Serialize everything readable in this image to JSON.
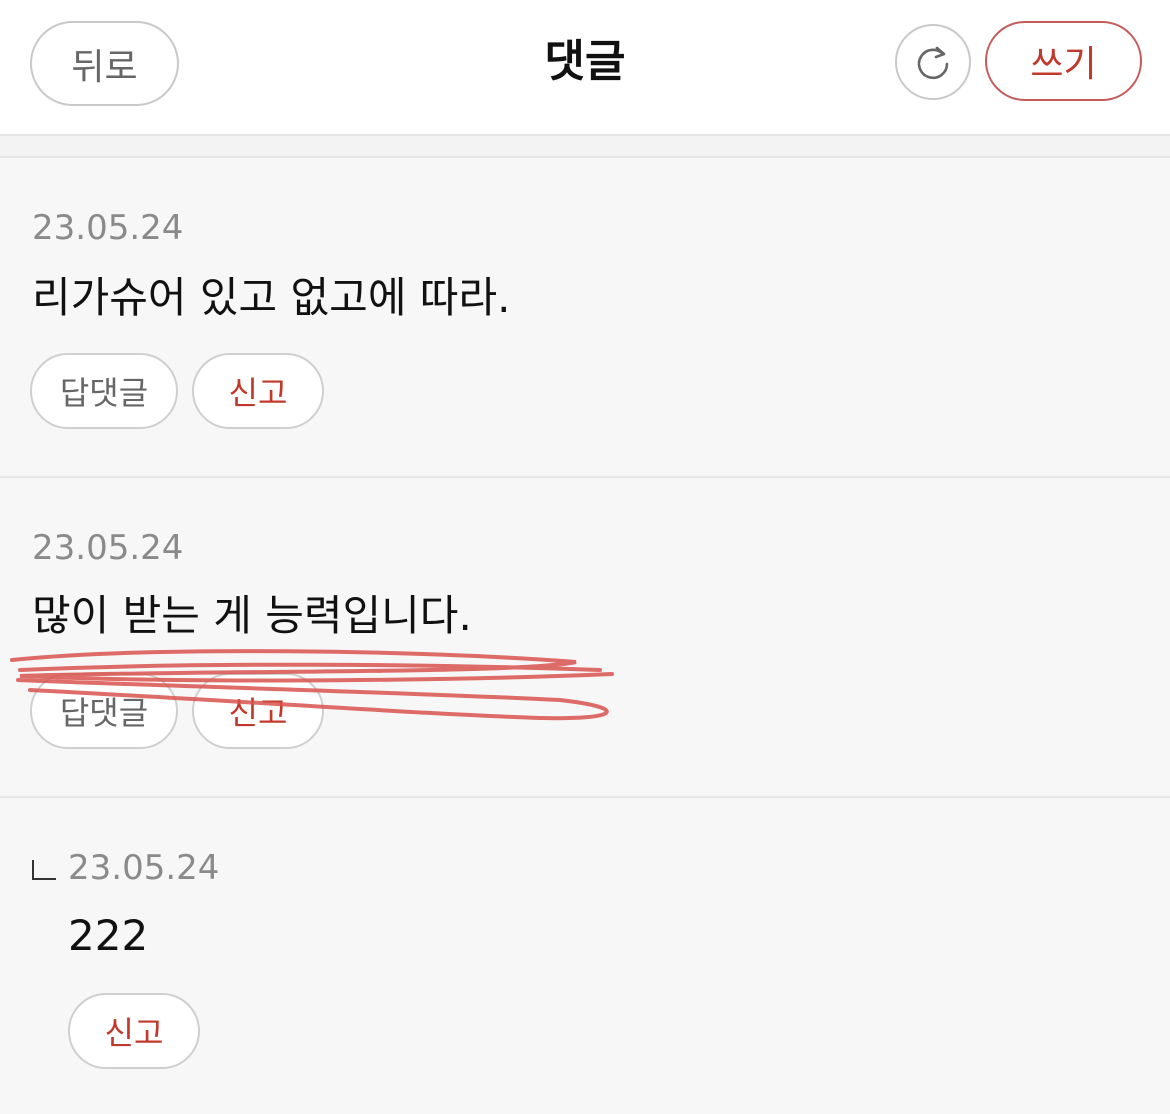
{
  "header": {
    "back_label": "뒤로",
    "title": "댓글",
    "refresh_icon": "refresh-icon",
    "write_label": "쓰기"
  },
  "comments": [
    {
      "date": "23.05.24",
      "text": "리가슈어 있고 없고에 따라.",
      "reply_label": "답댓글",
      "report_label": "신고"
    },
    {
      "date": "23.05.24",
      "text": "많이 받는 게 능력입니다.",
      "reply_label": "답댓글",
      "report_label": "신고"
    }
  ],
  "reply": {
    "marker": "ㄴ",
    "date": "23.05.24",
    "text": "222",
    "report_label": "신고"
  },
  "colors": {
    "accent": "#c0392b",
    "scribble": "#d9534f",
    "background": "#f7f7f7"
  }
}
